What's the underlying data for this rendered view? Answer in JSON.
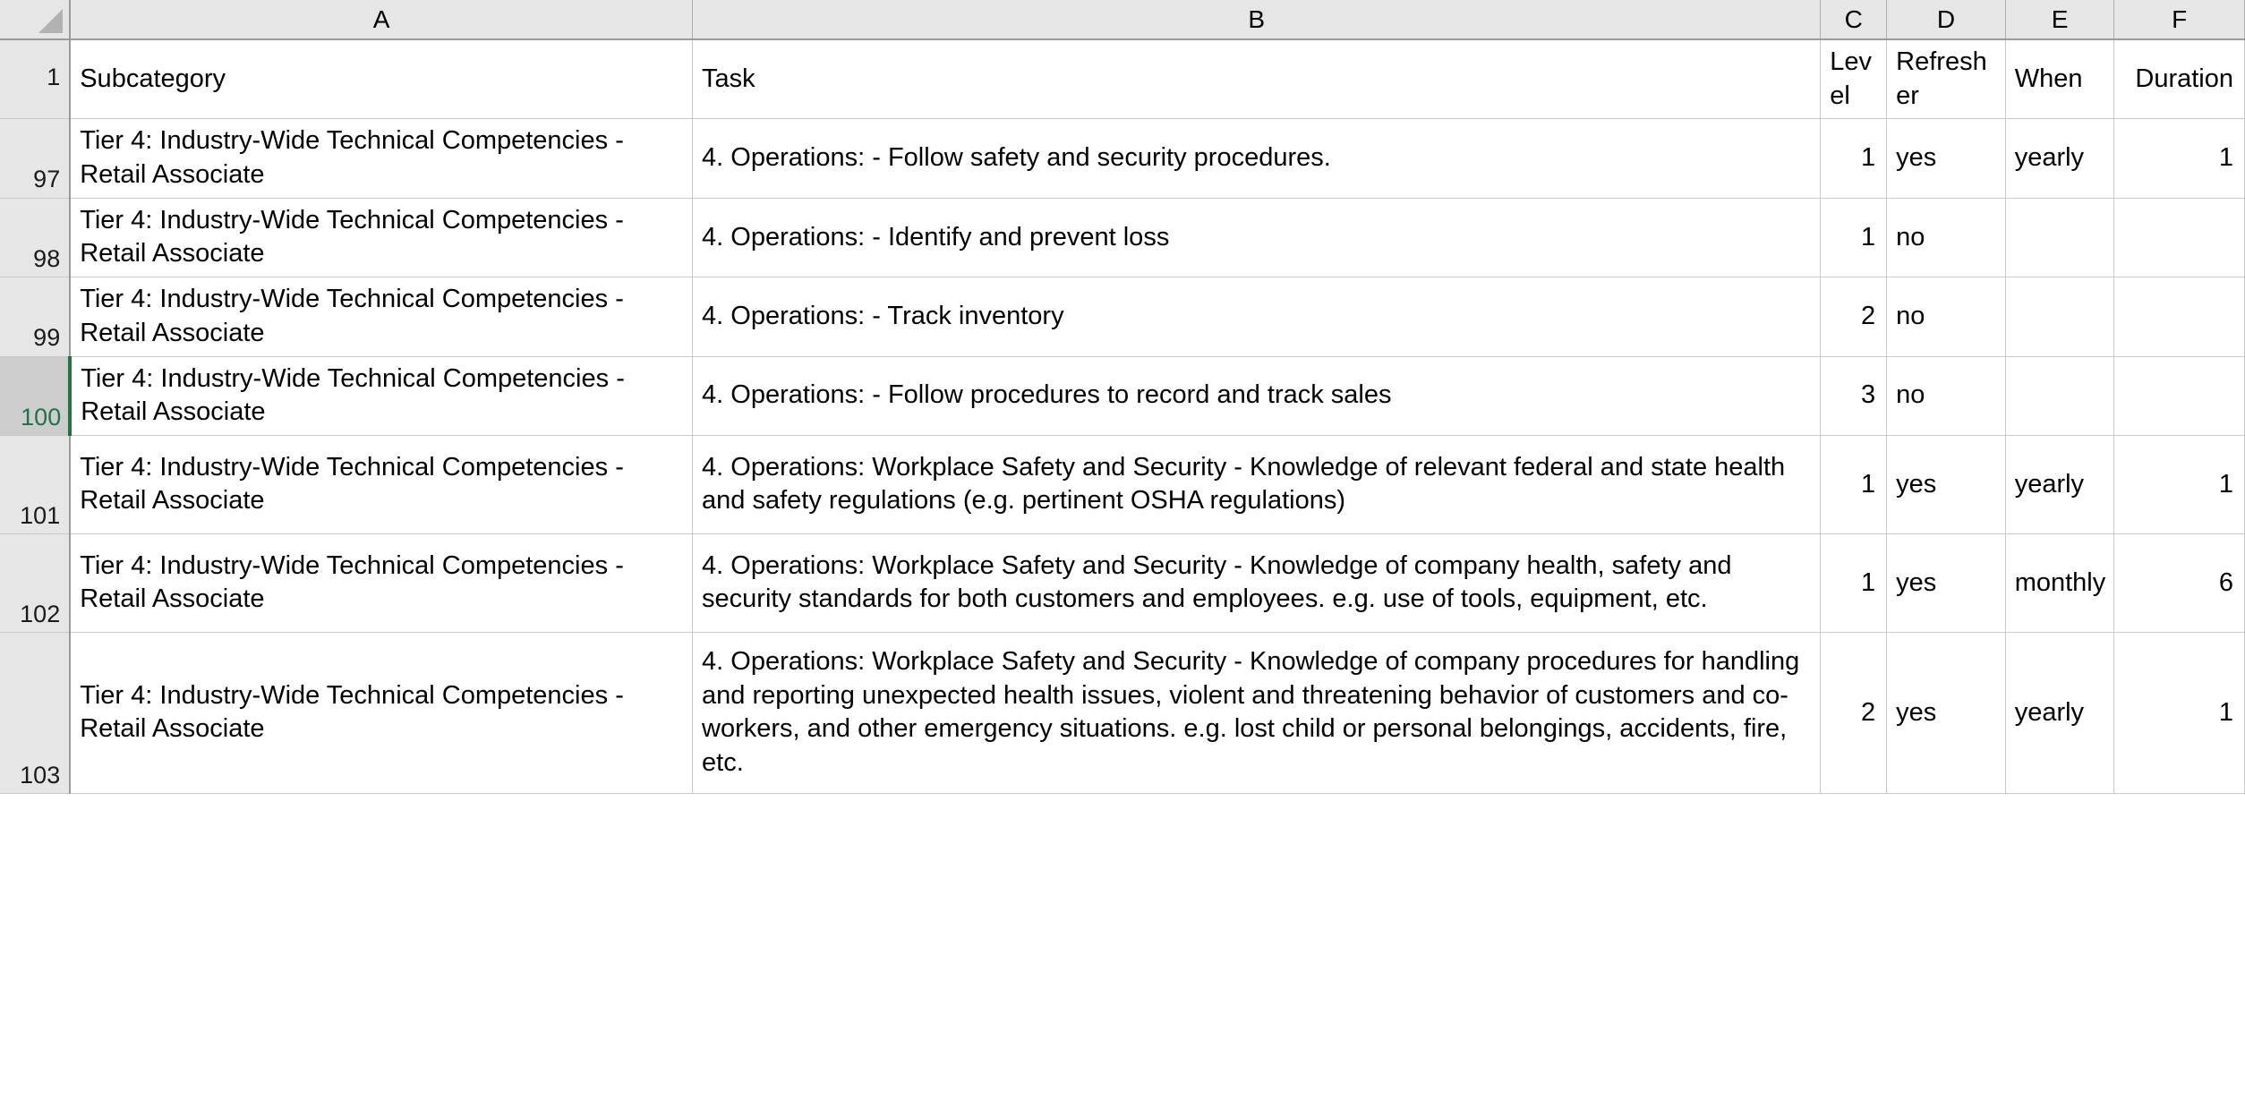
{
  "app": {
    "type": "spreadsheet",
    "select_all_icon": "select-all-triangle-icon",
    "selection": {
      "selected_row": "100",
      "accent_color": "#217346",
      "row_header_selected_bg": "#cdcdcd"
    },
    "colors": {
      "header_bg": "#e6e6e6",
      "gridline": "#c9c9c9",
      "header_border": "#9a9a9a",
      "cell_bg": "#ffffff",
      "text": "#000000"
    }
  },
  "columns": [
    {
      "letter": "A",
      "align": "left"
    },
    {
      "letter": "B",
      "align": "left"
    },
    {
      "letter": "C",
      "align": "right"
    },
    {
      "letter": "D",
      "align": "left"
    },
    {
      "letter": "E",
      "align": "left"
    },
    {
      "letter": "F",
      "align": "right"
    }
  ],
  "header_row": {
    "number": "1",
    "cells": {
      "a": "Subcategory",
      "b": "Task",
      "c": "Level",
      "d": "Refresher",
      "e": "When",
      "f": "Duration"
    }
  },
  "rows": [
    {
      "number": "97",
      "selected": false,
      "subcategory": "Tier 4:  Industry-Wide Technical Competencies - Retail Associate",
      "task": "4. Operations: - Follow safety and security procedures.",
      "level": "1",
      "refresher": "yes",
      "when": "yearly",
      "duration": "1"
    },
    {
      "number": "98",
      "selected": false,
      "subcategory": "Tier 4:  Industry-Wide Technical Competencies - Retail Associate",
      "task": "4. Operations: - Identify and prevent loss",
      "level": "1",
      "refresher": "no",
      "when": "",
      "duration": ""
    },
    {
      "number": "99",
      "selected": false,
      "subcategory": "Tier 4:  Industry-Wide Technical Competencies - Retail Associate",
      "task": "4. Operations: - Track inventory",
      "level": "2",
      "refresher": "no",
      "when": "",
      "duration": ""
    },
    {
      "number": "100",
      "selected": true,
      "subcategory": "Tier 4:  Industry-Wide Technical Competencies - Retail Associate",
      "task": "4. Operations: - Follow procedures to record and track sales",
      "level": "3",
      "refresher": "no",
      "when": "",
      "duration": ""
    },
    {
      "number": "101",
      "selected": false,
      "subcategory": "Tier 4:  Industry-Wide Technical Competencies - Retail Associate",
      "task": "4. Operations: Workplace Safety and Security - Knowledge of relevant federal and state health and safety regulations (e.g. pertinent OSHA regulations)",
      "level": "1",
      "refresher": "yes",
      "when": "yearly",
      "duration": "1"
    },
    {
      "number": "102",
      "selected": false,
      "subcategory": "Tier 4:  Industry-Wide Technical Competencies - Retail Associate",
      "task": "4. Operations: Workplace Safety and Security - Knowledge of company health, safety and security standards for both customers and employees. e.g. use of tools, equipment, etc.",
      "level": "1",
      "refresher": "yes",
      "when": "monthly",
      "duration": "6"
    },
    {
      "number": "103",
      "selected": false,
      "subcategory": "Tier 4:  Industry-Wide Technical Competencies - Retail Associate",
      "task": "4. Operations: Workplace Safety and Security - Knowledge of company procedures for handling and reporting unexpected health issues, violent and threatening behavior of customers and co-workers, and other emergency situations.  e.g. lost child or personal belongings, accidents, fire, etc.",
      "level": "2",
      "refresher": "yes",
      "when": "yearly",
      "duration": "1"
    }
  ]
}
